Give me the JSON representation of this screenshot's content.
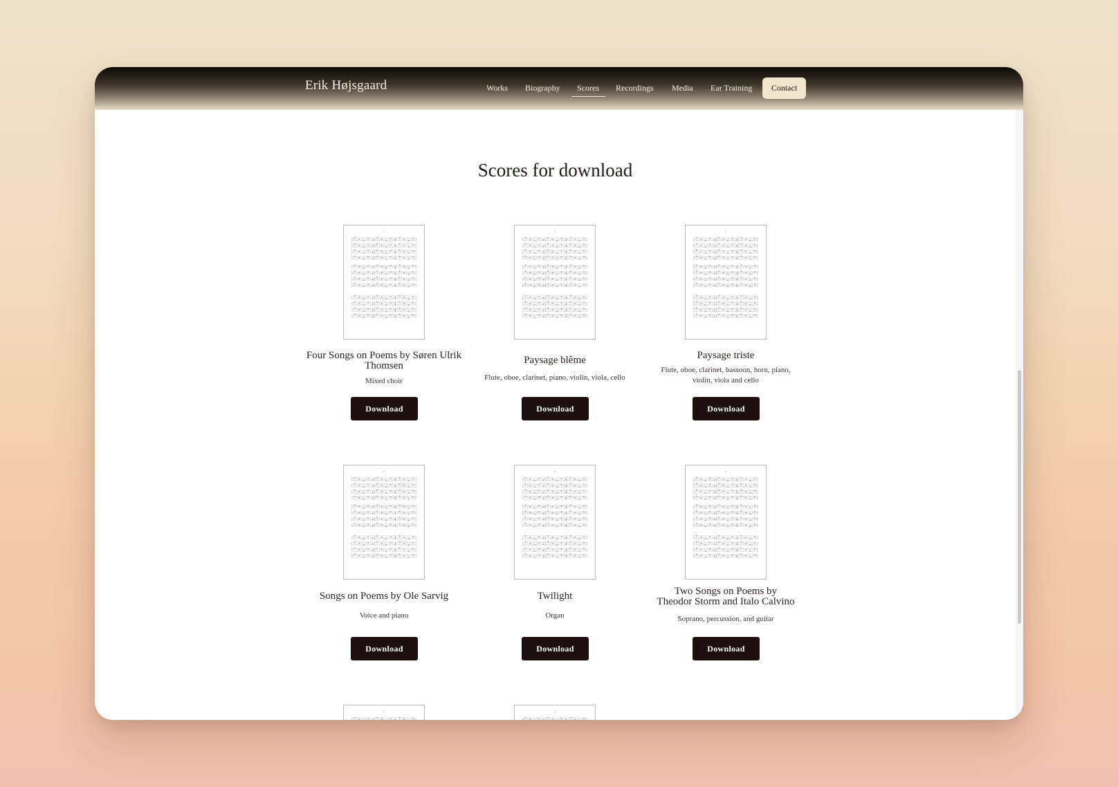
{
  "nav": {
    "brand": "Erik Højsgaard",
    "items": [
      "Works",
      "Biography",
      "Scores",
      "Recordings",
      "Media",
      "Ear Training"
    ],
    "active": "Scores",
    "contact_label": "Contact"
  },
  "main": {
    "heading": "Scores for download",
    "download_label": "Download",
    "scores": [
      {
        "title": "Four Songs on Poems by Søren Ulrik Thomsen",
        "instrumentation": "Mixed choir"
      },
      {
        "title": "Paysage blême",
        "instrumentation": "Flute, oboe, clarinet, piano, violin, viola, cello"
      },
      {
        "title": "Paysage triste",
        "instrumentation": "Flute, oboe, clarinet, bassoon, horn, piano, violin, viola and cello"
      },
      {
        "title": "Songs on Poems by Ole Sarvig",
        "instrumentation": "Voice and piano"
      },
      {
        "title": "Twilight",
        "instrumentation": "Organ"
      },
      {
        "title": "Two Songs on Poems by Theodor Storm and Italo Calvino",
        "instrumentation": "Soprano, percussion, and guitar"
      }
    ]
  },
  "colors": {
    "accent_dark": "#1c0f0d",
    "contact_bg": "#f3e6ce",
    "nav_text": "#f5efe4"
  },
  "icons": {
    "score_thumbnail": "sheet-music-thumbnail"
  }
}
